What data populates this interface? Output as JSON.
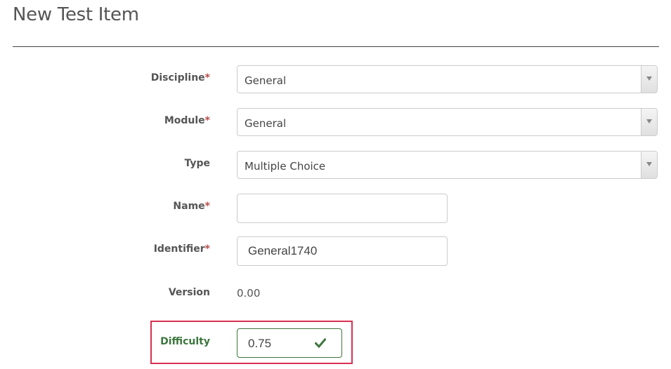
{
  "page": {
    "title": "New Test Item"
  },
  "form": {
    "required_marker": "*",
    "discipline": {
      "label": "Discipline",
      "value": "General"
    },
    "module": {
      "label": "Module",
      "value": "General"
    },
    "type": {
      "label": "Type",
      "value": "Multiple Choice"
    },
    "name": {
      "label": "Name",
      "value": ""
    },
    "identifier": {
      "label": "Identifier",
      "value": "General1740"
    },
    "version": {
      "label": "Version",
      "value": "0.00"
    },
    "difficulty": {
      "label": "Difficulty",
      "value": "0.75",
      "valid_icon": "check-icon"
    }
  },
  "colors": {
    "required": "#b94a48",
    "success": "#3c763d",
    "highlight": "#d9304f",
    "text": "#555555"
  }
}
